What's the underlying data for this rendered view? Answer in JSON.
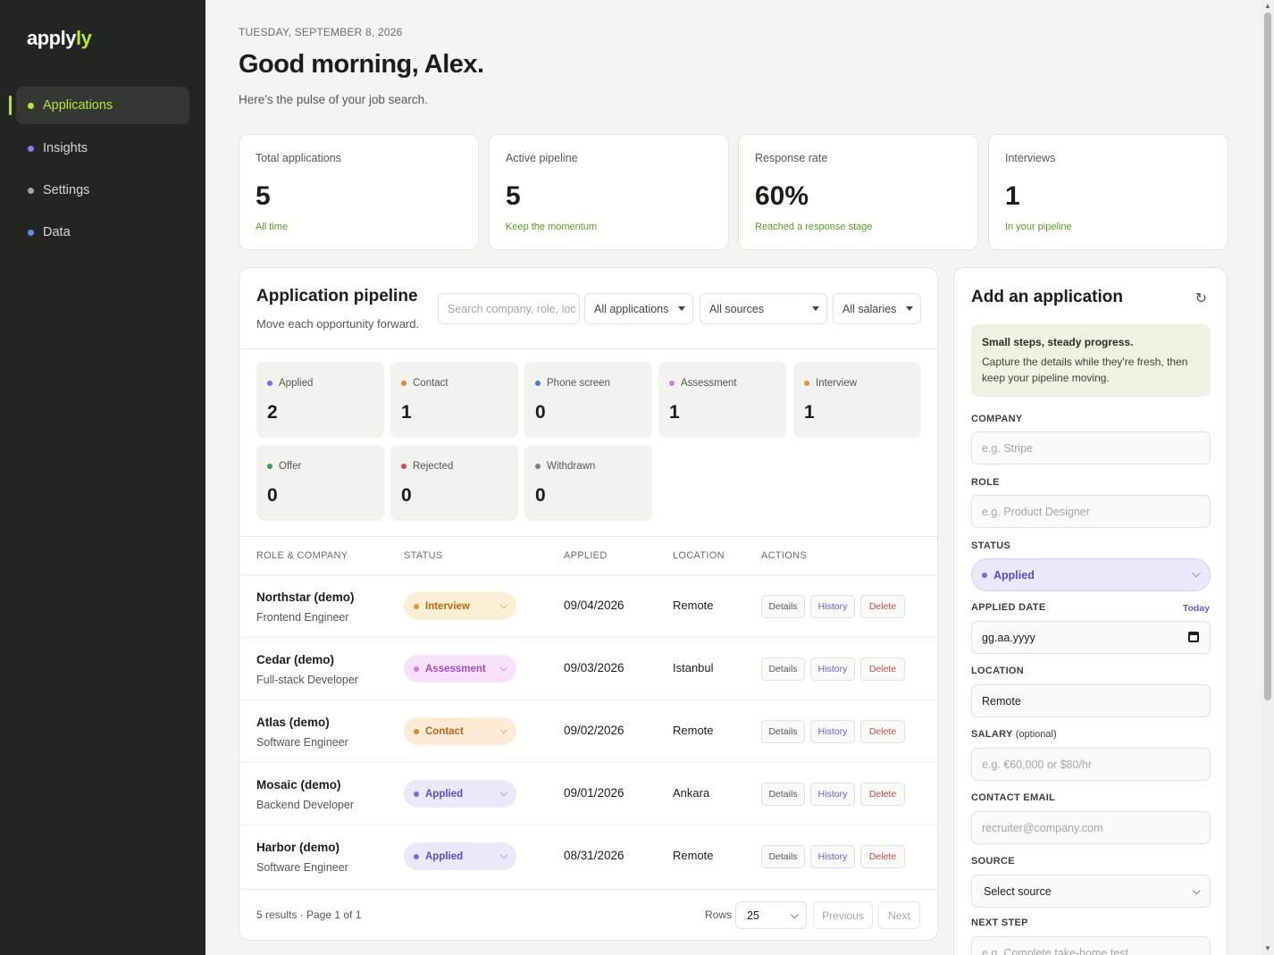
{
  "app": {
    "logo_main": "apply",
    "logo_accent": "ly"
  },
  "sidebar": {
    "items": [
      {
        "label": "Applications",
        "color": "#b6e63c"
      },
      {
        "label": "Insights",
        "color": "#8b7ce8"
      },
      {
        "label": "Settings",
        "color": "#a5a6a1"
      },
      {
        "label": "Data",
        "color": "#5b8ee6"
      }
    ]
  },
  "header": {
    "date": "TUESDAY, SEPTEMBER 8, 2026",
    "greeting": "Good morning, Alex.",
    "subtitle": "Here's the pulse of your job search."
  },
  "stats": [
    {
      "label": "Total applications",
      "value": "5",
      "hint": "All time"
    },
    {
      "label": "Active pipeline",
      "value": "5",
      "hint": "Keep the momentum"
    },
    {
      "label": "Response rate",
      "value": "60%",
      "hint": "Reached a response stage"
    },
    {
      "label": "Interviews",
      "value": "1",
      "hint": "In your pipeline"
    }
  ],
  "pipeline": {
    "title": "Application pipeline",
    "subtitle": "Move each opportunity forward.",
    "search_placeholder": "Search company, role, loc",
    "filters": {
      "applications": "All applications",
      "sources": "All sources",
      "salaries": "All salaries"
    },
    "stages": [
      {
        "label": "Applied",
        "count": "2",
        "color": "#7b6bd9"
      },
      {
        "label": "Contact",
        "count": "1",
        "color": "#e0892b"
      },
      {
        "label": "Phone screen",
        "count": "0",
        "color": "#3a7fd8"
      },
      {
        "label": "Assessment",
        "count": "1",
        "color": "#d47ae0"
      },
      {
        "label": "Interview",
        "count": "1",
        "color": "#e8932b"
      },
      {
        "label": "Offer",
        "count": "0",
        "color": "#3a9a4e"
      },
      {
        "label": "Rejected",
        "count": "0",
        "color": "#d94b4b"
      },
      {
        "label": "Withdrawn",
        "count": "0",
        "color": "#7d7f7a"
      }
    ],
    "columns": {
      "role_company": "ROLE & COMPANY",
      "status": "STATUS",
      "applied": "APPLIED",
      "location": "LOCATION",
      "actions": "ACTIONS"
    },
    "rows": [
      {
        "company": "Northstar (demo)",
        "role": "Frontend Engineer",
        "status": "Interview",
        "applied": "09/04/2026",
        "location": "Remote"
      },
      {
        "company": "Cedar (demo)",
        "role": "Full-stack Developer",
        "status": "Assessment",
        "applied": "09/03/2026",
        "location": "Istanbul"
      },
      {
        "company": "Atlas (demo)",
        "role": "Software Engineer",
        "status": "Contact",
        "applied": "09/02/2026",
        "location": "Remote"
      },
      {
        "company": "Mosaic (demo)",
        "role": "Backend Developer",
        "status": "Applied",
        "applied": "09/01/2026",
        "location": "Ankara"
      },
      {
        "company": "Harbor (demo)",
        "role": "Software Engineer",
        "status": "Applied",
        "applied": "08/31/2026",
        "location": "Remote"
      }
    ],
    "actions": {
      "details": "Details",
      "history": "History",
      "delete": "Delete"
    },
    "footer": {
      "summary": "5 results · Page 1 of 1",
      "rows_label": "Rows",
      "rows_value": "25",
      "previous": "Previous",
      "next": "Next"
    }
  },
  "add_form": {
    "title": "Add an application",
    "tip_title": "Small steps, steady progress.",
    "tip_body": "Capture the details while they're fresh, then keep your pipeline moving.",
    "company_label": "COMPANY",
    "company_placeholder": "e.g. Stripe",
    "role_label": "ROLE",
    "role_placeholder": "e.g. Product Designer",
    "status_label": "STATUS",
    "status_value": "Applied",
    "applied_date_label": "APPLIED DATE",
    "today_link": "Today",
    "applied_date_placeholder": "gg.aa.yyyy",
    "location_label": "LOCATION",
    "location_value": "Remote",
    "salary_label": "SALARY",
    "salary_optional": "(optional)",
    "salary_placeholder": "e.g. €60,000 or $80/hr",
    "email_label": "CONTACT EMAIL",
    "email_placeholder": "recruiter@company.com",
    "source_label": "SOURCE",
    "source_value": "Select source",
    "next_step_label": "NEXT STEP",
    "next_step_placeholder": "e.g. Complete take-home test"
  }
}
